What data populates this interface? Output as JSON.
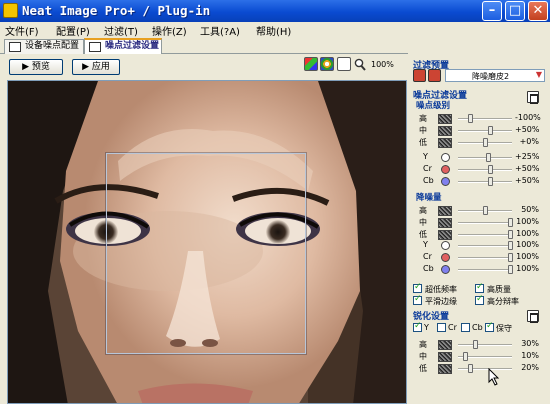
{
  "window": {
    "title": "Neat Image Pro+ / Plug-in",
    "min_symbol": "–",
    "max_symbol": "□",
    "close_symbol": "✕"
  },
  "menu": [
    "文件(F)",
    "配置(P)",
    "过滤(T)",
    "操作(Z)",
    "工具(?A)",
    "帮助(H)"
  ],
  "tabs": [
    {
      "label": "设备噪点配置"
    },
    {
      "label": "噪点过滤设置",
      "active": true
    }
  ],
  "toolbar": {
    "preview_label": "▶ 预览",
    "apply_label": "▶ 应用",
    "zoom": "100%"
  },
  "preset": {
    "title": "过滤预置",
    "value": "降噪磨皮2"
  },
  "noise": {
    "title": "噪点过滤设置",
    "level_title": "噪点级别",
    "freq_rows": [
      {
        "label": "高",
        "value": "-100%",
        "level": 0.2
      },
      {
        "label": "中",
        "value": "+50%",
        "level": 0.6
      },
      {
        "label": "低",
        "value": "+0%",
        "level": 0.5
      }
    ],
    "channel_rows": [
      {
        "label": "Y",
        "value": "+25%",
        "level": 0.55,
        "color": "#ffffff"
      },
      {
        "label": "Cr",
        "value": "+50%",
        "level": 0.6,
        "color": "#e06060"
      },
      {
        "label": "Cb",
        "value": "+50%",
        "level": 0.6,
        "color": "#8080ee"
      }
    ]
  },
  "reduce": {
    "title": "降噪量",
    "freq_rows": [
      {
        "label": "高",
        "value": "50%",
        "level": 0.5
      },
      {
        "label": "中",
        "value": "100%",
        "level": 1.0
      },
      {
        "label": "低",
        "value": "100%",
        "level": 1.0
      }
    ],
    "channel_rows": [
      {
        "label": "Y",
        "value": "100%",
        "level": 1.0,
        "color": "#ffffff"
      },
      {
        "label": "Cr",
        "value": "100%",
        "level": 1.0,
        "color": "#e06060"
      },
      {
        "label": "Cb",
        "value": "100%",
        "level": 1.0,
        "color": "#8080ee"
      }
    ]
  },
  "options": [
    {
      "label": "超低频率",
      "checked": true
    },
    {
      "label": "高质量",
      "checked": true
    },
    {
      "label": "平滑边缘",
      "checked": true
    },
    {
      "label": "高分辩率",
      "checked": true
    }
  ],
  "sharpen": {
    "title": "锐化设置",
    "channels": [
      {
        "label": "Y",
        "checked": true
      },
      {
        "label": "Cr",
        "checked": false
      },
      {
        "label": "Cb",
        "checked": false
      },
      {
        "label": "保守",
        "checked": true
      }
    ],
    "rows": [
      {
        "label": "高",
        "value": "30%",
        "level": 0.3
      },
      {
        "label": "中",
        "value": "10%",
        "level": 0.1
      },
      {
        "label": "低",
        "value": "20%",
        "level": 0.2
      }
    ]
  }
}
